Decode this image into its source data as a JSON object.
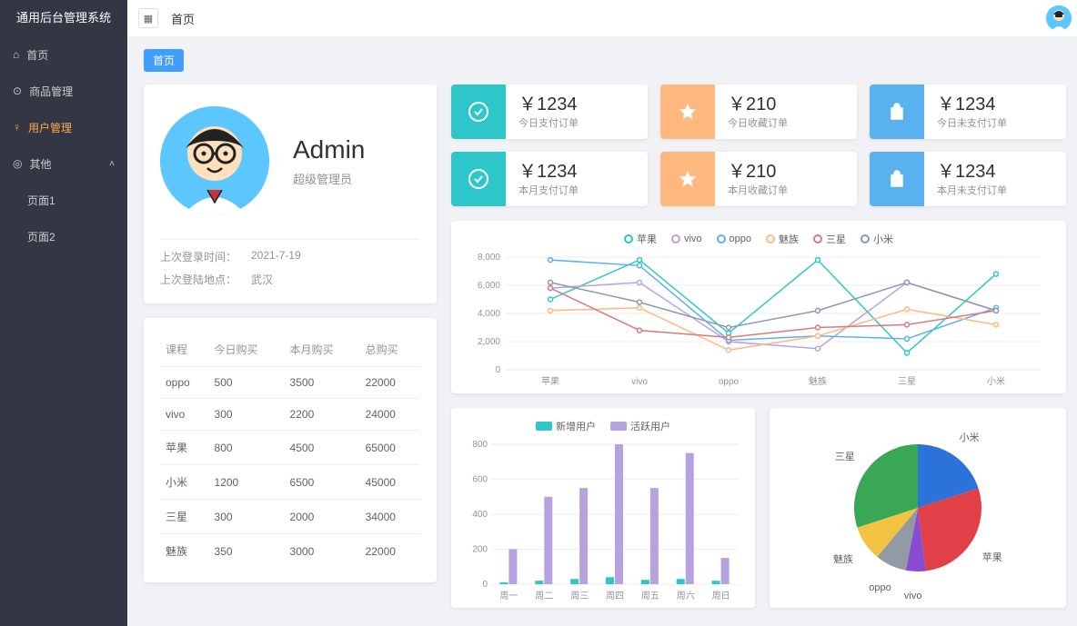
{
  "app_title": "通用后台管理系统",
  "header": {
    "breadcrumb": "首页"
  },
  "tag": "首页",
  "sidebar": {
    "items": [
      {
        "label": "首页",
        "icon": "home"
      },
      {
        "label": "商品管理",
        "icon": "play"
      },
      {
        "label": "用户管理",
        "icon": "user",
        "active": true
      },
      {
        "label": "其他",
        "icon": "location",
        "children": [
          {
            "label": "页面1"
          },
          {
            "label": "页面2"
          }
        ]
      }
    ]
  },
  "user": {
    "name": "Admin",
    "role": "超级管理员",
    "last_login_time_label": "上次登录时间：",
    "last_login_time": "2021-7-19",
    "last_login_loc_label": "上次登陆地点：",
    "last_login_loc": "武汉"
  },
  "table": {
    "headers": [
      "课程",
      "今日购买",
      "本月购买",
      "总购买"
    ],
    "rows": [
      [
        "oppo",
        "500",
        "3500",
        "22000"
      ],
      [
        "vivo",
        "300",
        "2200",
        "24000"
      ],
      [
        "苹果",
        "800",
        "4500",
        "65000"
      ],
      [
        "小米",
        "1200",
        "6500",
        "45000"
      ],
      [
        "三星",
        "300",
        "2000",
        "34000"
      ],
      [
        "魅族",
        "350",
        "3000",
        "22000"
      ]
    ]
  },
  "stats": [
    {
      "value": "￥1234",
      "label": "今日支付订单",
      "color": "teal",
      "icon": "check"
    },
    {
      "value": "￥210",
      "label": "今日收藏订单",
      "color": "orange",
      "icon": "star"
    },
    {
      "value": "￥1234",
      "label": "今日未支付订单",
      "color": "blue",
      "icon": "bag"
    },
    {
      "value": "￥1234",
      "label": "本月支付订单",
      "color": "teal",
      "icon": "check"
    },
    {
      "value": "￥210",
      "label": "本月收藏订单",
      "color": "orange",
      "icon": "star"
    },
    {
      "value": "￥1234",
      "label": "本月未支付订单",
      "color": "blue",
      "icon": "bag"
    }
  ],
  "chart_data": [
    {
      "type": "line",
      "categories": [
        "苹果",
        "vivo",
        "oppo",
        "魅族",
        "三星",
        "小米"
      ],
      "ylim": [
        0,
        8000
      ],
      "yticks": [
        0,
        2000,
        4000,
        6000,
        8000
      ],
      "series": [
        {
          "name": "苹果",
          "color": "#2ec7c9",
          "values": [
            5000,
            7800,
            2600,
            7800,
            1200,
            6800
          ]
        },
        {
          "name": "vivo",
          "color": "#b6a2de",
          "values": [
            5800,
            6200,
            2000,
            1500,
            6200,
            4200
          ]
        },
        {
          "name": "oppo",
          "color": "#5ab1ef",
          "values": [
            7800,
            7400,
            2100,
            2400,
            2200,
            4400
          ]
        },
        {
          "name": "魅族",
          "color": "#ffb980",
          "values": [
            4200,
            4400,
            1400,
            2400,
            4300,
            3200
          ]
        },
        {
          "name": "三星",
          "color": "#d87a80",
          "values": [
            5800,
            2800,
            2300,
            3000,
            3200,
            4200
          ]
        },
        {
          "name": "小米",
          "color": "#8d98b3",
          "values": [
            6200,
            4800,
            3000,
            4200,
            6200,
            4200
          ]
        }
      ]
    },
    {
      "type": "bar",
      "categories": [
        "周一",
        "周二",
        "周三",
        "周四",
        "周五",
        "周六",
        "周日"
      ],
      "ylim": [
        0,
        800
      ],
      "yticks": [
        0,
        200,
        400,
        600,
        800
      ],
      "series": [
        {
          "name": "新增用户",
          "color": "#2ec7c9",
          "values": [
            10,
            20,
            30,
            40,
            25,
            30,
            20
          ]
        },
        {
          "name": "活跃用户",
          "color": "#b6a2de",
          "values": [
            200,
            500,
            550,
            800,
            550,
            750,
            150
          ]
        }
      ]
    },
    {
      "type": "pie",
      "series": [
        {
          "name": "小米",
          "color": "#2b73d8",
          "value": 20
        },
        {
          "name": "苹果",
          "color": "#e24049",
          "value": 28
        },
        {
          "name": "vivo",
          "color": "#8a4bd3",
          "value": 5
        },
        {
          "name": "oppo",
          "color": "#929aa3",
          "value": 8
        },
        {
          "name": "魅族",
          "color": "#f3c342",
          "value": 9
        },
        {
          "name": "三星",
          "color": "#3aa757",
          "value": 30
        }
      ]
    }
  ]
}
